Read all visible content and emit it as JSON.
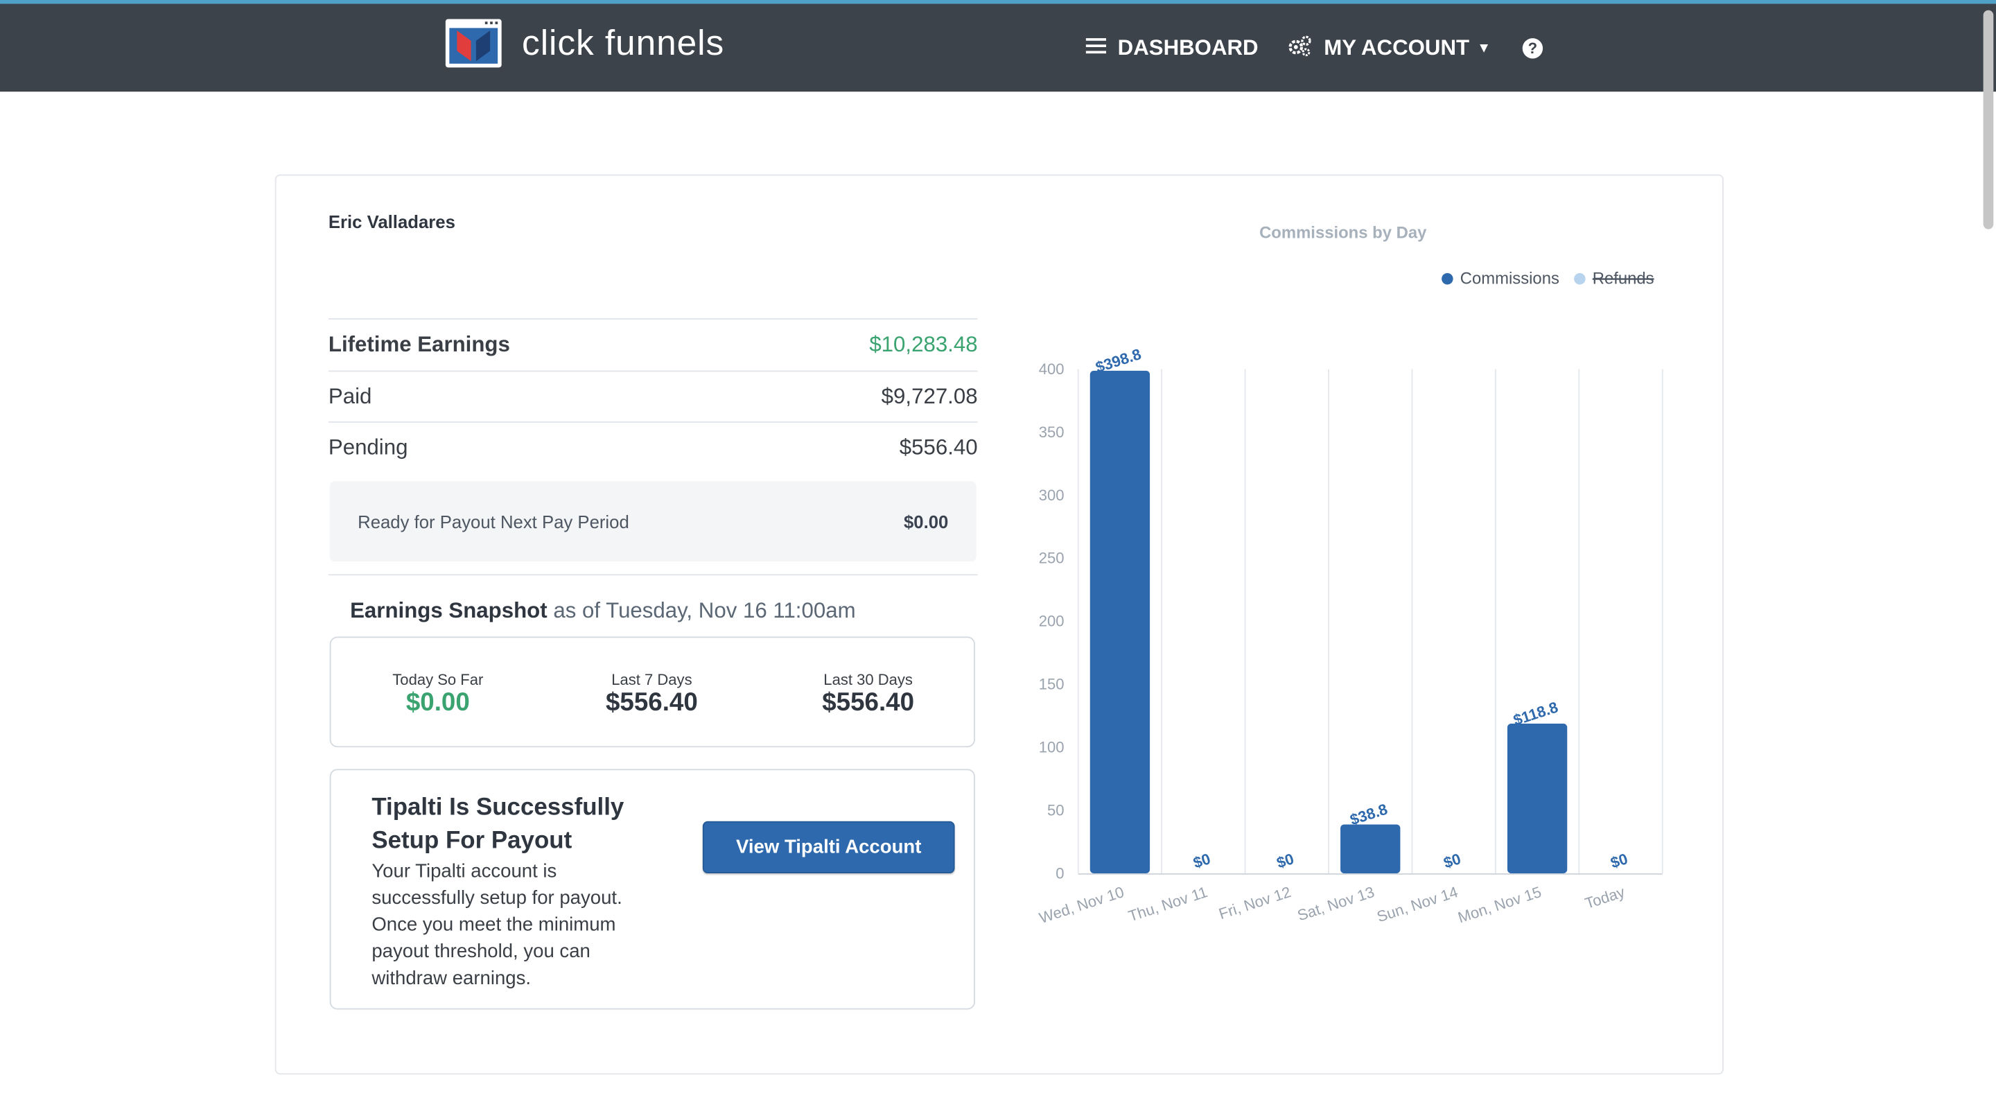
{
  "header": {
    "brand": "click funnels",
    "nav": {
      "dashboard": "DASHBOARD",
      "my_account": "MY ACCOUNT",
      "help": "?"
    }
  },
  "user": {
    "name": "Eric Valladares"
  },
  "earnings": {
    "lifetime": {
      "label": "Lifetime Earnings",
      "value": "$10,283.48"
    },
    "paid": {
      "label": "Paid",
      "value": "$9,727.08"
    },
    "pending": {
      "label": "Pending",
      "value": "$556.40"
    },
    "ready": {
      "label": "Ready for Payout Next Pay Period",
      "value": "$0.00"
    }
  },
  "snapshot": {
    "title": "Earnings Snapshot",
    "as_of": "as of Tuesday, Nov 16 11:00am",
    "stats": [
      {
        "label": "Today So Far",
        "value": "$0.00"
      },
      {
        "label": "Last 7 Days",
        "value": "$556.40"
      },
      {
        "label": "Last 30 Days",
        "value": "$556.40"
      }
    ]
  },
  "tipalti": {
    "title": "Tipalti Is Successfully Setup For Payout",
    "body": "Your Tipalti account is successfully setup for payout. Once you meet the minimum payout threshold, you can withdraw earnings.",
    "button": "View Tipalti Account"
  },
  "colors": {
    "commissions": "#2e69ad",
    "refunds": "#b7d3ee",
    "positive": "#3aa36f"
  },
  "chart_data": {
    "type": "bar",
    "title": "Commissions by Day",
    "categories": [
      "Wed, Nov 10",
      "Thu, Nov 11",
      "Fri, Nov 12",
      "Sat, Nov 13",
      "Sun, Nov 14",
      "Mon, Nov 15",
      "Today"
    ],
    "series": [
      {
        "name": "Commissions",
        "values": [
          398.8,
          0,
          0,
          38.8,
          0,
          118.8,
          0
        ]
      }
    ],
    "data_labels": [
      "$398.8",
      "$0",
      "$0",
      "$38.8",
      "$0",
      "$118.8",
      "$0"
    ],
    "legend": [
      {
        "name": "Commissions",
        "active": true
      },
      {
        "name": "Refunds",
        "active": false
      }
    ],
    "legend_position": "top-right",
    "ylim": [
      0,
      400
    ],
    "yticks": [
      0,
      50,
      100,
      150,
      200,
      250,
      300,
      350,
      400
    ],
    "grid": true
  }
}
